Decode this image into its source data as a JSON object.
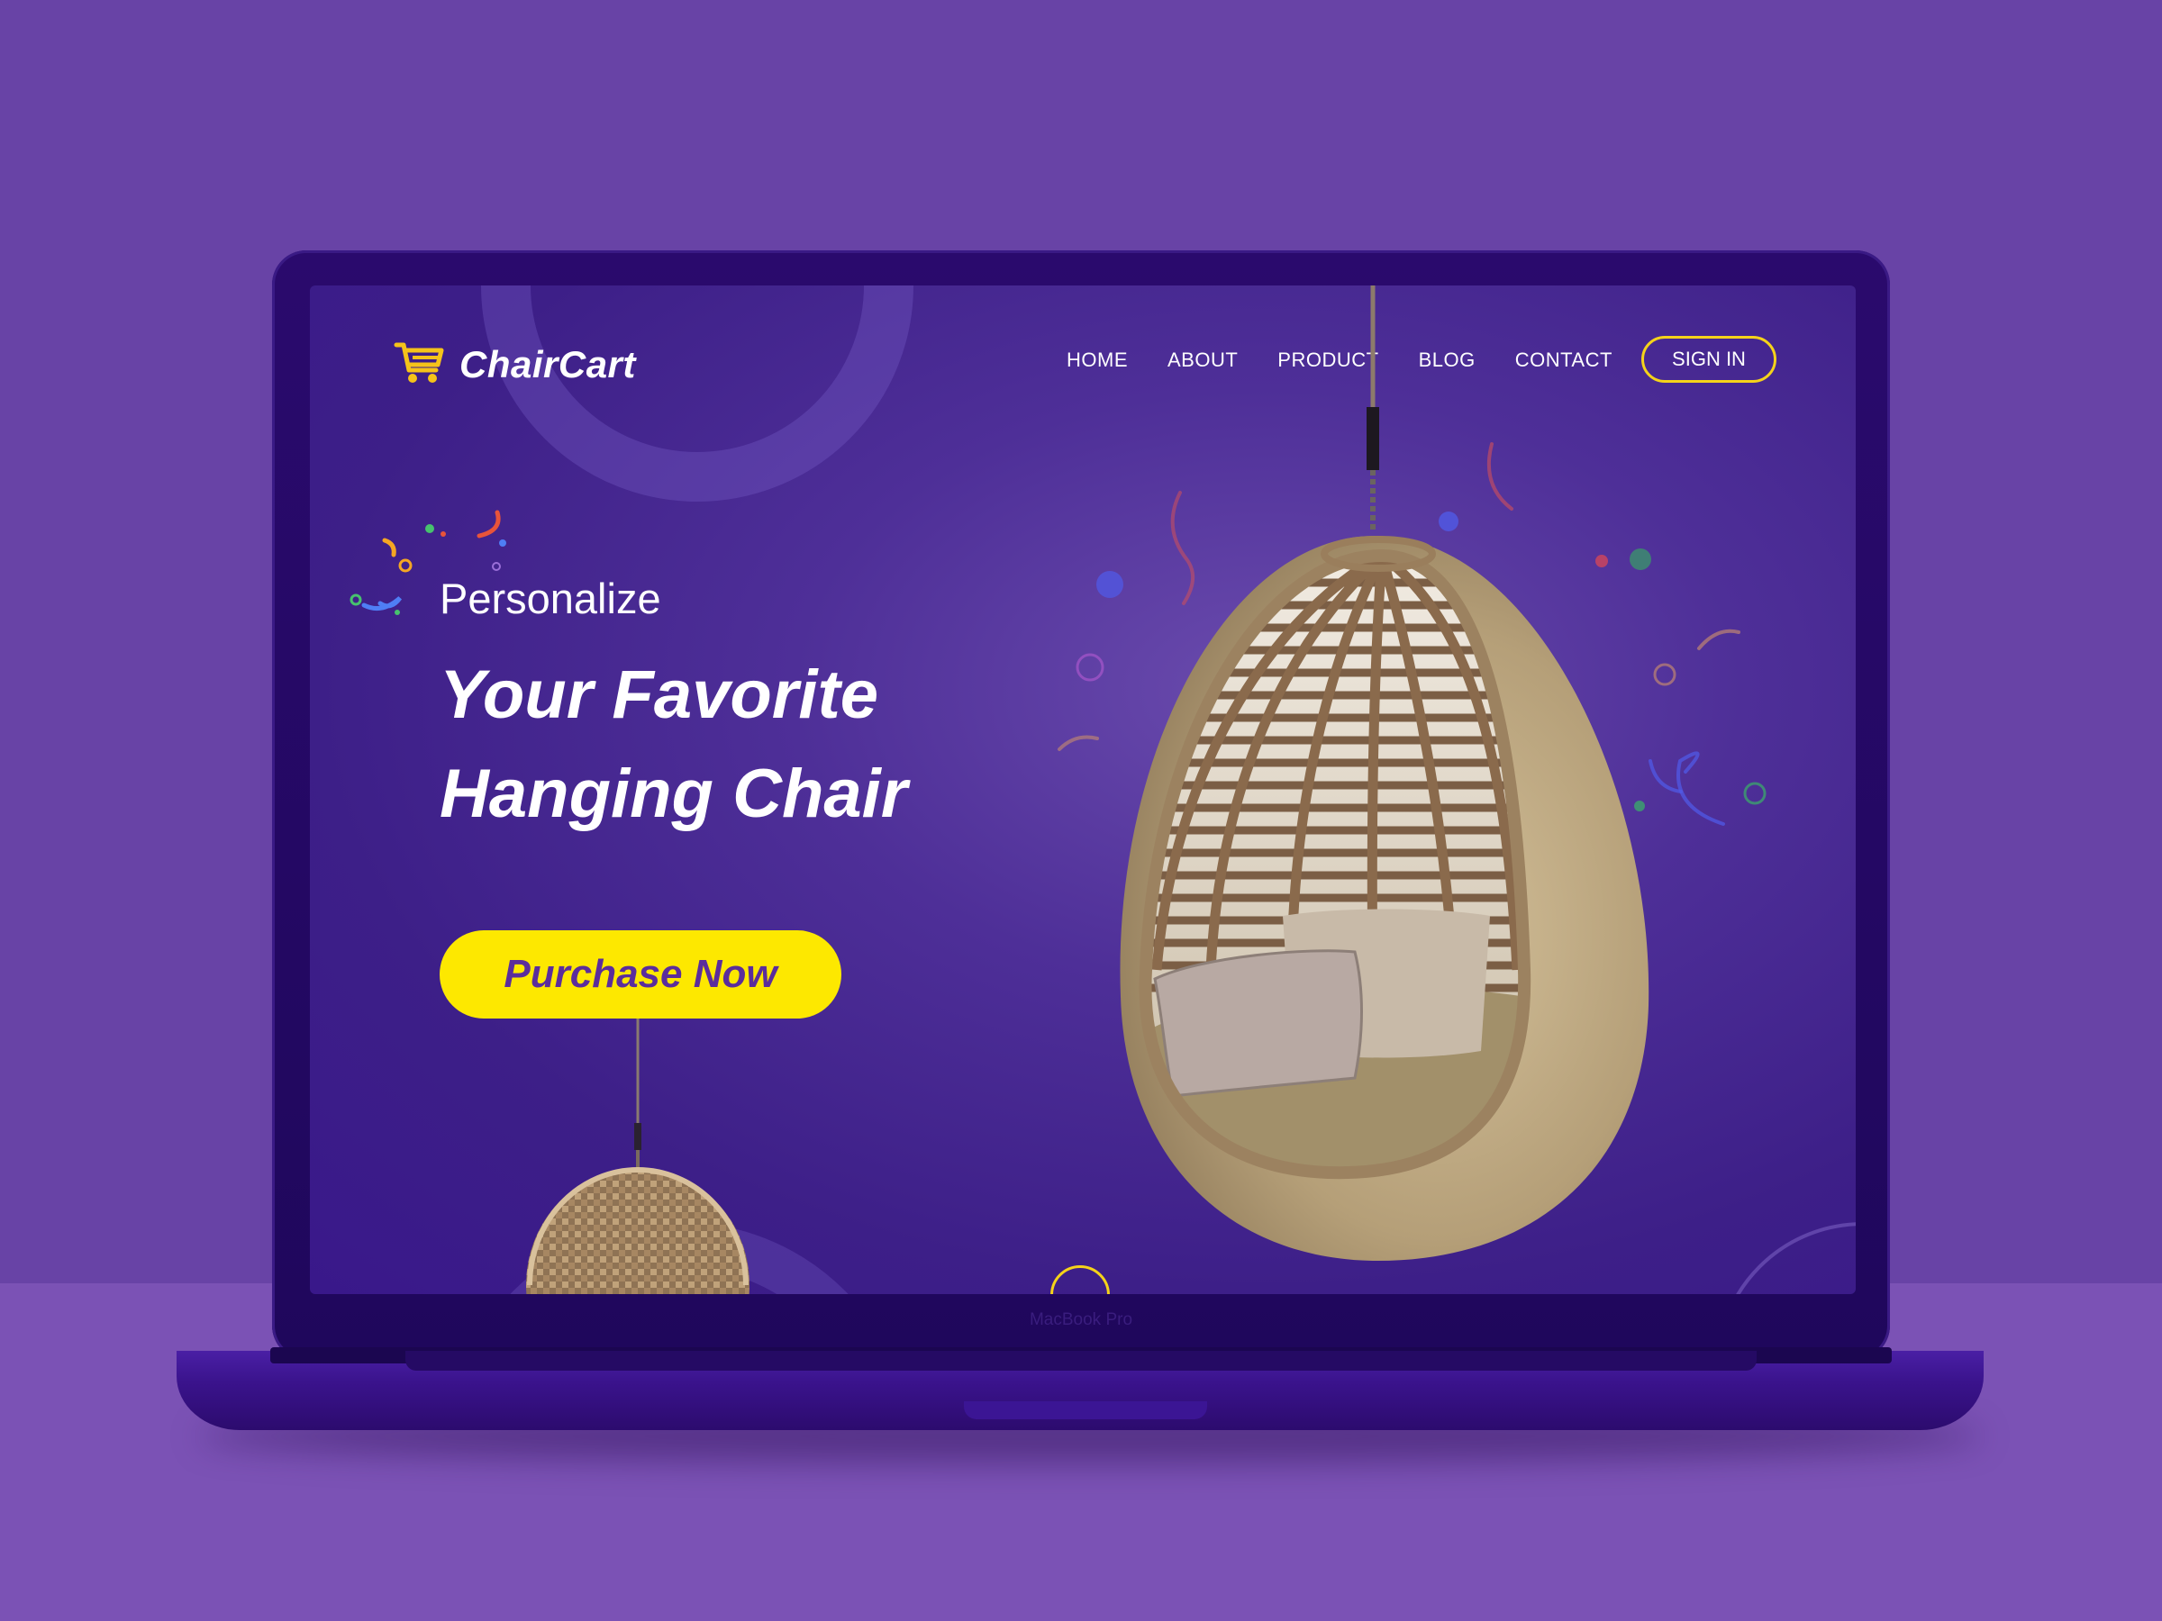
{
  "device": {
    "label": "MacBook Pro"
  },
  "site": {
    "brand": "ChairCart",
    "nav": [
      "HOME",
      "ABOUT",
      "PRODUCT",
      "BLOG",
      "CONTACT"
    ],
    "signin_label": "SIGN IN"
  },
  "hero": {
    "subtitle": "Personalize",
    "headline_line1": "Your Favorite",
    "headline_line2": "Hanging Chair",
    "cta_label": "Purchase Now"
  },
  "icons": {
    "logo": "shopping-cart-icon"
  },
  "colors": {
    "background": "#6843a6",
    "screen": "#3d1f88",
    "accent": "#fde800",
    "cta_text": "#5b2d9c"
  }
}
